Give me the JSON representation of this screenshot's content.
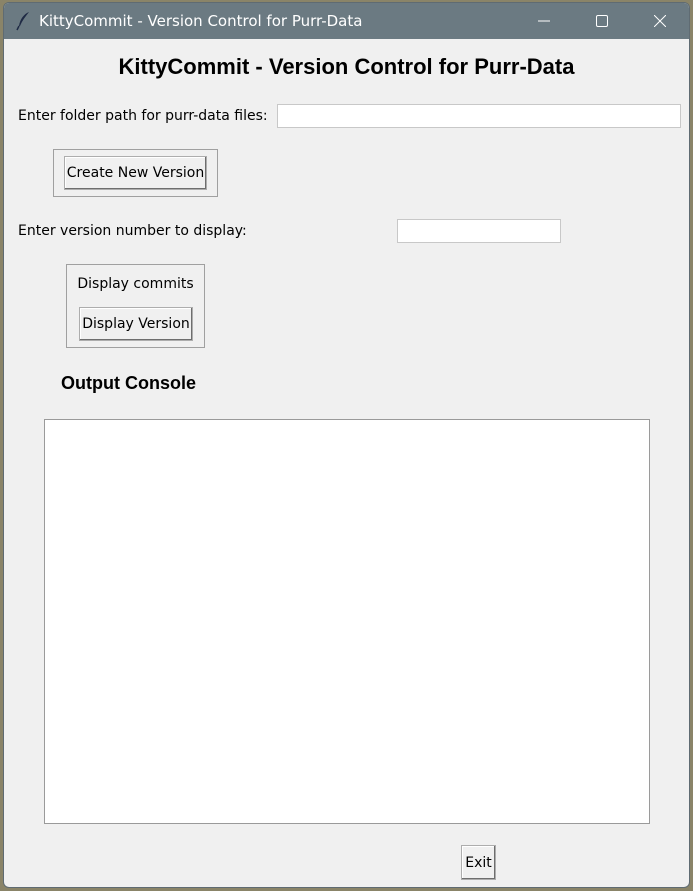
{
  "window": {
    "title": "KittyCommit - Version Control for Purr-Data",
    "icon": "feather-icon",
    "controls": {
      "minimize_icon": "minimize-icon",
      "maximize_icon": "maximize-icon",
      "close_icon": "close-icon"
    },
    "titlebar_color": "#6b7a82"
  },
  "main": {
    "heading": "KittyCommit - Version Control for Purr-Data",
    "folder_path": {
      "label": "Enter folder path for purr-data files:",
      "value": ""
    },
    "create_version_button": "Create New Version",
    "version_number": {
      "label": "Enter version number to display:",
      "value": ""
    },
    "display_frame": {
      "label": "Display commits",
      "button": "Display Version"
    },
    "console": {
      "heading": "Output Console",
      "content": ""
    },
    "exit_button": "Exit"
  }
}
